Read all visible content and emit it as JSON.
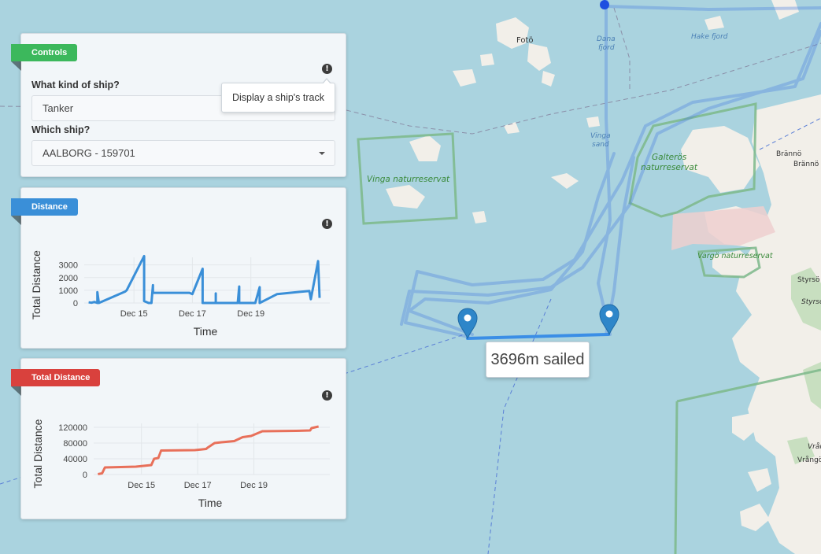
{
  "map": {
    "place_labels": {
      "foto": "Fotö",
      "dana_fjord": "Dana\nfjord",
      "hake_fjord": "Hake fjord",
      "vinga_sand": "Vinga\nsand",
      "vinga_reserve": "Vinga naturreservat",
      "galteros_reserve": "Galterös\nnaturreservat",
      "varga_reserve": "Vargö naturreservat",
      "branno": "Brännö",
      "branno2": "Brännö",
      "styrso": "Styrsö",
      "styrso2": "Styrsö",
      "vrangö": "Vrångö",
      "vrang2": "Vrån"
    },
    "route_label": "3696m sailed",
    "colors": {
      "water": "#aad3df",
      "land": "#f2efe9",
      "route": "#3b8ee6",
      "track": "#4a7fe0",
      "reserve": "#7db88a"
    }
  },
  "controls": {
    "ribbon": "Controls",
    "ribbon_color": "#3cb85c",
    "ship_type_label": "What kind of ship?",
    "ship_type_value": "Tanker",
    "ship_label": "Which ship?",
    "ship_value": "AALBORG - 159701",
    "info_tooltip": "Display a ship's track"
  },
  "distance_panel": {
    "ribbon": "Distance",
    "ribbon_color": "#3a8fd8",
    "line_color": "#3a8fd8"
  },
  "total_panel": {
    "ribbon": "Total Distance",
    "ribbon_color": "#d9413d",
    "line_color": "#e8705a"
  },
  "chart_data": [
    {
      "type": "line",
      "title": "",
      "xlabel": "Time",
      "ylabel": "Total Distance",
      "x_ticks": [
        "Dec 15",
        "Dec 17",
        "Dec 19"
      ],
      "y_ticks": [
        "0",
        "1000",
        "2000",
        "3000"
      ],
      "ylim": [
        0,
        3600
      ],
      "xlim": [
        13.3,
        21.7
      ],
      "grid": true,
      "series": [
        {
          "x": [
            13.45,
            13.55,
            13.65,
            13.75,
            13.75,
            13.8,
            14.7,
            14.75,
            15.35,
            15.35,
            15.5,
            15.6,
            15.65,
            15.65,
            16.9,
            17.0,
            17.35,
            17.35,
            17.8,
            17.8,
            17.8,
            18.55,
            18.6,
            18.6,
            18.6,
            19.15,
            19.3,
            19.3,
            19.9,
            21.0,
            21.05,
            21.3,
            21.35
          ],
          "y": [
            50,
            20,
            80,
            0,
            850,
            0,
            900,
            1000,
            3700,
            150,
            0,
            0,
            1400,
            800,
            800,
            700,
            2700,
            0,
            0,
            750,
            0,
            0,
            1300,
            0,
            0,
            0,
            1250,
            0,
            700,
            950,
            300,
            3300,
            400
          ]
        }
      ]
    },
    {
      "type": "line",
      "title": "",
      "xlabel": "Time",
      "ylabel": "Total Distance",
      "x_ticks": [
        "Dec 15",
        "Dec 17",
        "Dec 19"
      ],
      "y_ticks": [
        "0",
        "40000",
        "80000",
        "120000"
      ],
      "ylim": [
        0,
        130000
      ],
      "xlim": [
        13.3,
        21.7
      ],
      "grid": true,
      "series": [
        {
          "x": [
            13.45,
            13.6,
            13.7,
            14.0,
            14.8,
            15.35,
            15.45,
            15.6,
            15.7,
            16.9,
            17.3,
            17.35,
            17.6,
            17.85,
            18.3,
            18.6,
            18.9,
            19.3,
            20.5,
            21.0,
            21.05,
            21.3
          ],
          "y": [
            1000,
            3000,
            18000,
            18500,
            20000,
            24000,
            40000,
            42000,
            61000,
            62000,
            65000,
            68000,
            80000,
            82000,
            85000,
            95000,
            98000,
            110000,
            111000,
            112000,
            118000,
            122000
          ]
        }
      ]
    }
  ]
}
